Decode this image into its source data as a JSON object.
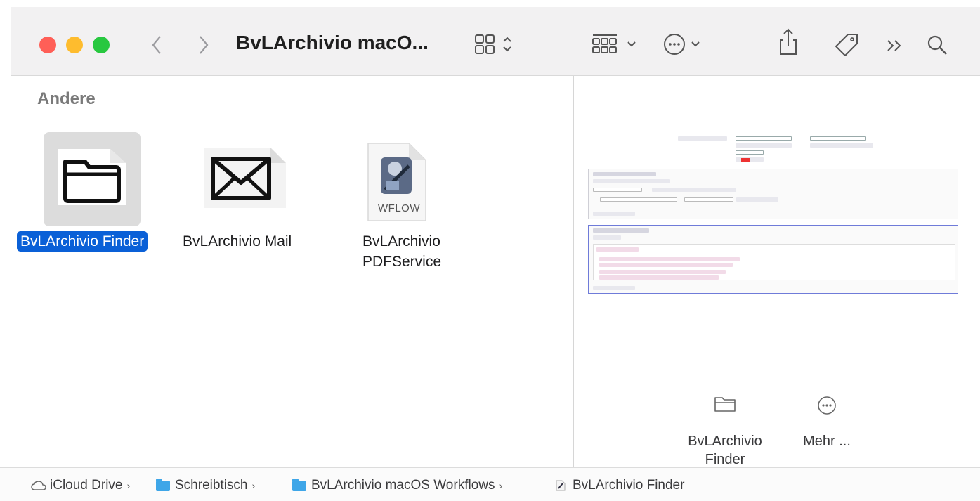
{
  "window": {
    "title": "BvLArchivio macO..."
  },
  "sidebar_section": {
    "header": "Andere"
  },
  "items": [
    {
      "label": "BvLArchivio Finder",
      "selected": true,
      "icon": "folder-document-icon"
    },
    {
      "label": "BvLArchivio Mail",
      "selected": false,
      "icon": "mail-document-icon"
    },
    {
      "label": "BvLArchivio",
      "label2": "PDFService",
      "selected": false,
      "icon": "automator-workflow-icon",
      "badge": "WFLOW"
    }
  ],
  "quick_actions": [
    {
      "label": "BvLArchivio",
      "label2": "Finder",
      "icon": "folder-icon"
    },
    {
      "label": "Mehr ...",
      "icon": "ellipsis-circle-icon"
    }
  ],
  "pathbar": [
    {
      "label": "iCloud Drive",
      "icon": "cloud-icon"
    },
    {
      "label": "Schreibtisch",
      "icon": "folder-icon"
    },
    {
      "label": "BvLArchivio macOS Workflows",
      "icon": "folder-icon"
    },
    {
      "label": "BvLArchivio Finder",
      "icon": "workflow-icon"
    }
  ],
  "colors": {
    "selection": "#0a60d7",
    "close": "#ff5f57",
    "minimize": "#febc2e",
    "zoom": "#28c840"
  }
}
